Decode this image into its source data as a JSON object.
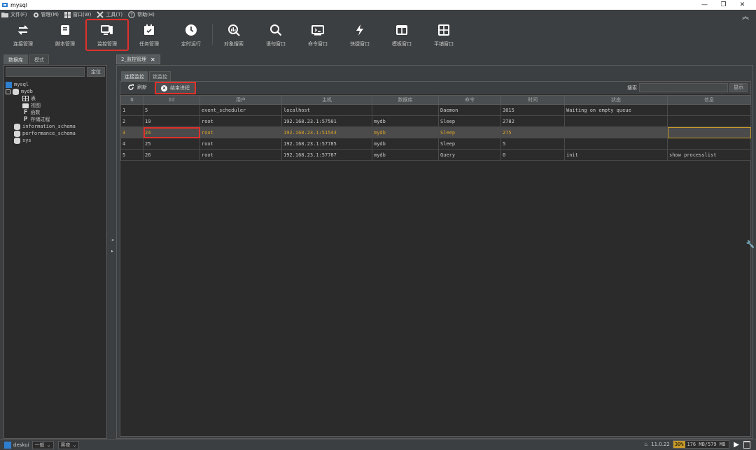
{
  "window": {
    "title": "mysql",
    "min": "—",
    "restore": "❐",
    "close": "✕"
  },
  "menus": [
    {
      "label": "文件(F)"
    },
    {
      "label": "管理(M)"
    },
    {
      "label": "窗口(W)"
    },
    {
      "label": "工具(T)"
    },
    {
      "label": "帮助(H)"
    }
  ],
  "toolbar": [
    {
      "label": "连接管理",
      "icon": "swap-icon"
    },
    {
      "label": "脚本管理",
      "icon": "book-icon"
    },
    {
      "label": "监控管理",
      "icon": "monitor-icon",
      "selected": true
    },
    {
      "label": "任务管理",
      "icon": "calendar-icon"
    },
    {
      "label": "定时运行",
      "icon": "clock-icon"
    },
    {
      "label": "对象搜索",
      "icon": "search-db-icon"
    },
    {
      "label": "语句窗口",
      "icon": "search-icon"
    },
    {
      "label": "命令窗口",
      "icon": "terminal-icon"
    },
    {
      "label": "快捷窗口",
      "icon": "bolt-icon"
    },
    {
      "label": "模板窗口",
      "icon": "template-icon"
    },
    {
      "label": "平铺窗口",
      "icon": "grid-icon"
    }
  ],
  "left": {
    "tabs": [
      "数据库",
      "模式"
    ],
    "locate_label": "定位",
    "tree": {
      "root": "mysql",
      "db": "mydb",
      "children": [
        "表",
        "视图",
        "函数",
        "存储过程"
      ],
      "others": [
        "information_schema",
        "performance_schema",
        "sys"
      ]
    }
  },
  "main": {
    "tab_label": "2_监控管理",
    "subtabs": [
      "连接监控",
      "锁监控"
    ],
    "refresh_label": "刷新",
    "kill_label": "结束进程",
    "search_label": "搜索",
    "show_label": "显示",
    "columns": [
      "N",
      "Id",
      "用户",
      "主机",
      "数据库",
      "命令",
      "时间",
      "状态",
      "信息"
    ],
    "rows": [
      [
        "1",
        "5",
        "event_scheduler",
        "localhost",
        "",
        "Daemon",
        "3015",
        "Waiting on empty queue",
        ""
      ],
      [
        "2",
        "19",
        "root",
        "192.168.23.1:57501",
        "mydb",
        "Sleep",
        "2782",
        "",
        ""
      ],
      [
        "3",
        "24",
        "root",
        "192.168.23.1:51543",
        "mydb",
        "Sleep",
        "275",
        "",
        ""
      ],
      [
        "4",
        "25",
        "root",
        "192.168.23.1:57785",
        "mydb",
        "Sleep",
        "5",
        "",
        ""
      ],
      [
        "5",
        "26",
        "root",
        "192.168.23.1:57787",
        "mydb",
        "Query",
        "0",
        "init",
        "show processlist"
      ]
    ],
    "selected_row": 2
  },
  "status": {
    "user": "deskui",
    "mode": "一般",
    "style": "黑夜",
    "version": "11.0.22",
    "mem_pct": "30%",
    "mem": "176 MB/579 MB"
  },
  "colors": {
    "accent": "#e0302b",
    "selected_text": "#d9a227",
    "bg": "#3c3f41"
  }
}
